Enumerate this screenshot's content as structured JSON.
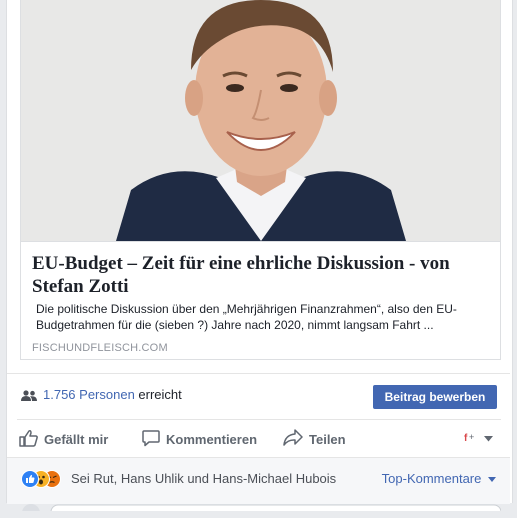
{
  "preview": {
    "headline": "EU-Budget – Zeit für eine ehrliche Diskussion - von Stefan Zotti",
    "description": "Die politische Diskussion über den „Mehrjährigen Finanzrahmen“, also den EU-Budgetrahmen für die (sieben ?) Jahre nach 2020, nimmt langsam Fahrt ...",
    "domain": "FISCHUNDFLEISCH.COM"
  },
  "reach": {
    "count": "1.756 Personen",
    "suffix": "erreicht",
    "promote_label": "Beitrag bewerben"
  },
  "actions": {
    "like": "Gefällt mir",
    "comment": "Kommentieren",
    "share": "Teilen"
  },
  "reactions": {
    "names": "Sei Rut, Hans Uhlik und Hans-Michael Hubois",
    "top_comments": "Top-Kommentare"
  },
  "colors": {
    "brand": "#4267b2",
    "like": "#2e81f4",
    "wow": "#f7b125",
    "angry": "#e9710f"
  },
  "icons": [
    "people-icon",
    "thumbs-up-icon",
    "comment-icon",
    "share-arrow-icon",
    "avatar-switcher-icon",
    "chevron-down-icon",
    "like-reaction-icon",
    "wow-reaction-icon",
    "angry-reaction-icon"
  ]
}
